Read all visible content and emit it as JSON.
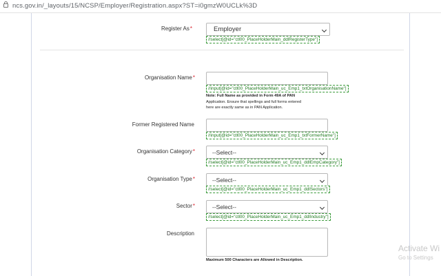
{
  "browser": {
    "url": "ncs.gov.in/_layouts/15/NCSP/Employer/Registration.aspx?ST=i0gmzW0UCLk%3D"
  },
  "form": {
    "register_as": {
      "label": "Register As",
      "required_mark": "*",
      "value": "Employer",
      "xpath": "//select[@id=\"ctl00_PlaceHolderMain_ddlRegisterType\"]"
    },
    "organisation_name": {
      "label": "Organisation Name",
      "required_mark": "*",
      "value": "",
      "xpath": "//input[@id=\"ctl00_PlaceHolderMain_uc_Emp1_txtOrganisationName\"]",
      "note_lines": [
        "Note: Full Name as provided in Form 49A of PAN",
        "Application. Ensure that spellings and full forms entered",
        "here are exactly same as in PAN Application."
      ]
    },
    "former_registered_name": {
      "label": "Former Registered Name",
      "value": "",
      "xpath": "//input[@id=\"ctl00_PlaceHolderMain_uc_Emp1_txtFormerName\"]"
    },
    "organisation_category": {
      "label": "Organisation Category",
      "required_mark": "*",
      "value": "--Select--",
      "xpath": "//select[@id=\"ctl00_PlaceHolderMain_uc_Emp1_ddlEmpCategory\"]"
    },
    "organisation_type": {
      "label": "Organisation Type",
      "required_mark": "*",
      "value": "--Select--",
      "xpath": "//select[@id=\"ctl00_PlaceHolderMain_uc_Emp1_ddlSectors\"]"
    },
    "sector": {
      "label": "Sector",
      "required_mark": "*",
      "value": "--Select--",
      "xpath": "//select[@id=\"ctl00_PlaceHolderMain_uc_Emp1_ddlIndustry\"]"
    },
    "description": {
      "label": "Description",
      "value": "",
      "note": "Maximum 500 Characters are Allowed in Description."
    }
  },
  "watermark": {
    "title": "Activate Wi",
    "subtitle": "Go to Settings"
  },
  "colors": {
    "required": "#d9212c",
    "xpath_text": "#1f7a1f",
    "panel_border": "#cfd6e6"
  }
}
